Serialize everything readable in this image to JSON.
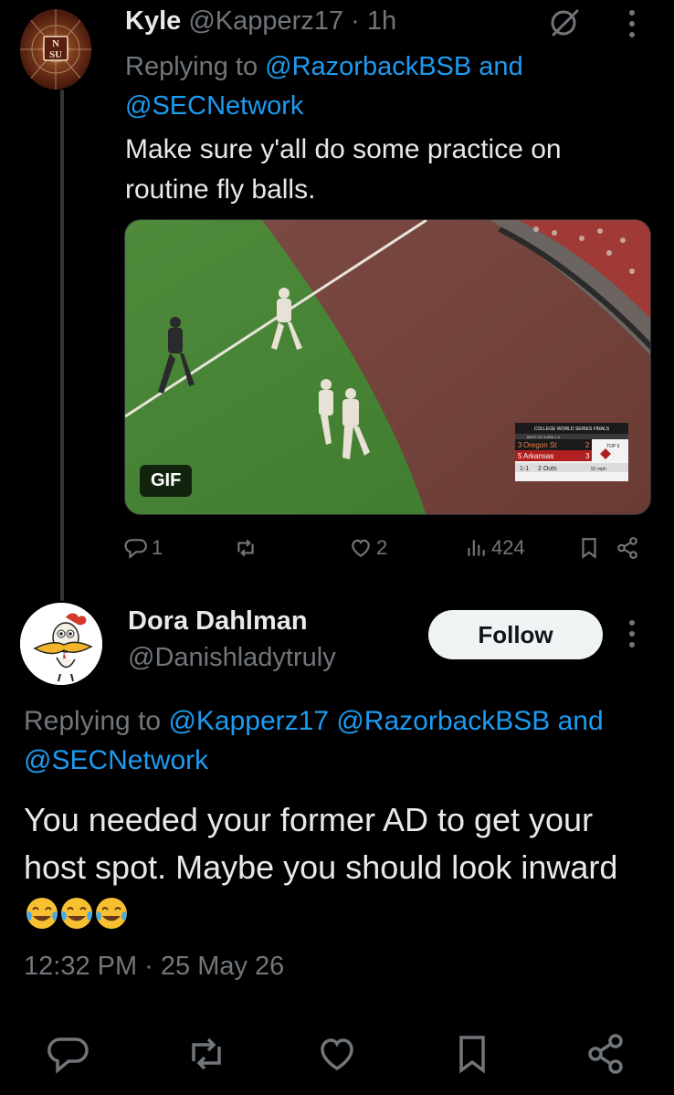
{
  "tweet1": {
    "name": "Kyle",
    "handle": "@Kapperz17",
    "separator": "·",
    "time": "1h",
    "reply_prefix": "Replying to ",
    "mention1": "@RazorbackBSB",
    "and": " and ",
    "mention2": "@SECNetwork",
    "text": "Make sure y'all do some practice on routine fly balls.",
    "gif_label": "GIF",
    "scoreboard": {
      "title": "COLLEGE WORLD SERIES FINALS",
      "subtitle": "BEST OF 3 ARK 1-0",
      "team1_seed": "3",
      "team1": "Oregon St",
      "team1_score": "2",
      "team2_seed": "5",
      "team2": "Arkansas",
      "team2_score": "3",
      "inning": "TOP 9",
      "count": "1-1",
      "outs": "2 Outs",
      "speed": "91 mph"
    },
    "stats": {
      "replies": "1",
      "reposts": "",
      "likes": "2",
      "views": "424"
    },
    "icons": [
      "grok-icon",
      "more-icon",
      "reply-icon",
      "repost-icon",
      "like-icon",
      "views-icon",
      "bookmark-icon",
      "share-icon"
    ]
  },
  "tweet2": {
    "name": "Dora Dahlman",
    "handle": "@Danishladytruly",
    "follow_label": "Follow",
    "reply_prefix": "Replying to ",
    "mention1": "@Kapperz17",
    "mention2": "@RazorbackBSB",
    "and": " and ",
    "mention3": "@SECNetwork",
    "text": "You needed your former AD to get your host spot. Maybe you should look inward",
    "emojis": [
      "face-with-tears-of-joy",
      "face-with-tears-of-joy",
      "face-with-tears-of-joy"
    ],
    "timestamp": "12:32 PM · 25 May 26",
    "icons": [
      "reply-icon",
      "repost-icon",
      "like-icon",
      "bookmark-icon",
      "share-icon"
    ]
  },
  "colors": {
    "background": "#000000",
    "text": "#e7e9ea",
    "secondary": "#71767b",
    "link": "#1d9bf0",
    "follow_bg": "#eff3f4"
  }
}
